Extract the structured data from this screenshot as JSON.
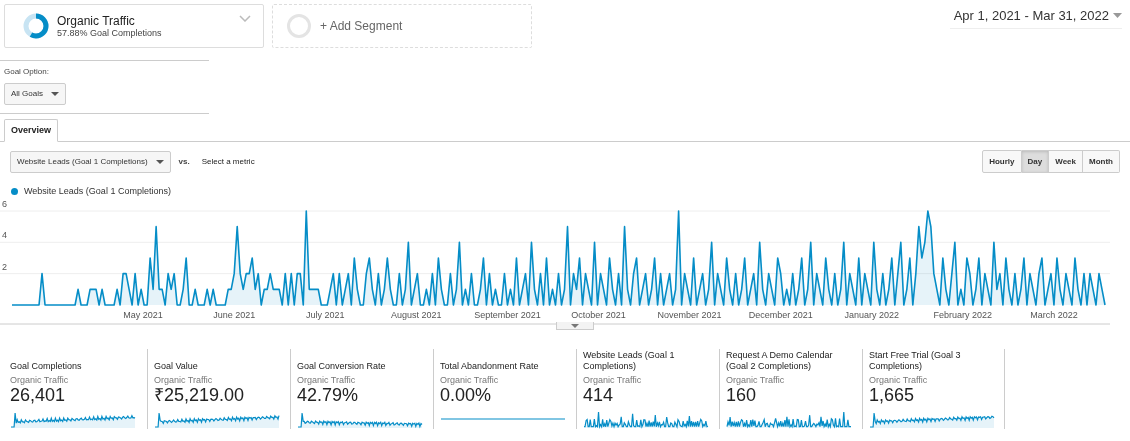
{
  "segments": [
    {
      "kind": "active",
      "name": "Organic Traffic",
      "subtitle": "57.88% Goal Completions"
    },
    {
      "kind": "add",
      "name": "+ Add Segment"
    }
  ],
  "date_range": "Apr 1, 2021 - Mar 31, 2022",
  "goal_option": {
    "label": "Goal Option:",
    "value": "All Goals"
  },
  "tabs": [
    {
      "label": "Overview",
      "selected": true
    }
  ],
  "metric_select": {
    "value": "Website Leads (Goal 1 Completions)",
    "vs": "vs.",
    "secondary": "Select a metric"
  },
  "granularity": [
    {
      "label": "Hourly",
      "selected": false
    },
    {
      "label": "Day",
      "selected": true
    },
    {
      "label": "Week",
      "selected": false
    },
    {
      "label": "Month",
      "selected": false
    }
  ],
  "chart": {
    "chart_data": {
      "type": "area",
      "series": [
        {
          "name": "Website Leads (Goal 1 Completions)",
          "color": "#058dc7",
          "values": [
            0,
            0,
            0,
            0,
            0,
            0,
            0,
            0,
            0,
            0,
            2,
            0,
            0,
            0,
            0,
            0,
            0,
            0,
            0,
            0,
            0,
            0,
            1,
            0,
            0,
            0,
            1,
            1,
            1,
            0,
            1,
            0,
            0,
            0,
            0,
            1,
            0,
            2,
            2,
            1,
            0,
            2,
            0,
            1,
            0,
            0,
            3,
            1,
            5,
            1,
            1,
            0,
            2,
            1,
            2,
            0,
            0,
            1,
            3,
            0,
            0,
            1,
            0,
            0,
            0,
            1,
            0,
            1,
            0,
            0,
            0,
            0,
            1,
            1,
            2,
            5,
            2,
            1,
            2,
            2,
            3,
            1,
            2,
            0,
            1,
            1,
            2,
            1,
            1,
            1,
            0,
            2,
            0,
            2,
            0,
            2,
            2,
            0,
            6,
            1,
            1,
            1,
            1,
            0,
            0,
            0,
            1,
            2,
            0,
            2,
            0,
            1,
            2,
            0,
            3,
            1,
            0,
            0,
            2,
            3,
            1,
            0,
            2,
            0,
            1,
            3,
            1,
            0,
            0,
            2,
            0,
            1,
            4,
            0,
            1,
            2,
            0,
            0,
            1,
            0,
            2,
            0,
            3,
            1,
            0,
            0,
            2,
            0,
            1,
            4,
            0,
            1,
            0,
            2,
            0,
            0,
            1,
            3,
            0,
            2,
            0,
            1,
            0,
            0,
            2,
            0,
            1,
            0,
            3,
            0,
            1,
            2,
            0,
            4,
            1,
            0,
            2,
            0,
            3,
            0,
            1,
            0,
            2,
            0,
            1,
            5,
            0,
            2,
            1,
            3,
            0,
            2,
            1,
            0,
            4,
            0,
            2,
            1,
            0,
            3,
            1,
            0,
            2,
            0,
            5,
            1,
            0,
            2,
            3,
            0,
            1,
            2,
            0,
            1,
            3,
            0,
            2,
            0,
            1,
            2,
            0,
            1,
            6,
            0,
            2,
            1,
            0,
            3,
            0,
            1,
            2,
            0,
            1,
            4,
            0,
            2,
            1,
            0,
            3,
            1,
            0,
            2,
            0,
            1,
            3,
            0,
            1,
            2,
            0,
            4,
            1,
            0,
            2,
            1,
            0,
            3,
            2,
            0,
            1,
            0,
            2,
            0,
            1,
            3,
            0,
            1,
            4,
            0,
            2,
            1,
            0,
            3,
            1,
            0,
            2,
            0,
            1,
            4,
            0,
            2,
            1,
            0,
            3,
            0,
            2,
            1,
            0,
            4,
            1,
            0,
            2,
            0,
            1,
            3,
            0,
            2,
            4,
            0,
            1,
            3,
            0,
            2,
            5,
            3,
            4,
            6,
            5,
            2,
            1,
            0,
            3,
            1,
            0,
            2,
            4,
            0,
            1,
            0,
            3,
            2,
            0,
            1,
            3,
            0,
            2,
            1,
            0,
            4,
            1,
            2,
            0,
            3,
            1,
            0,
            2,
            0,
            1,
            3,
            0,
            2,
            1,
            0,
            2,
            3,
            0,
            1,
            2,
            0,
            3,
            1,
            0,
            2,
            1,
            0,
            3,
            1,
            0,
            2,
            0,
            2,
            1,
            0,
            2,
            1,
            0
          ]
        }
      ],
      "ylim": [
        0,
        6
      ],
      "yticks": [
        2,
        4,
        6
      ],
      "grid": true
    },
    "axis_labels": [
      "May 2021",
      "June 2021",
      "July 2021",
      "August 2021",
      "September 2021",
      "October 2021",
      "November 2021",
      "December 2021",
      "January 2022",
      "February 2022",
      "March 2022"
    ]
  },
  "scorecards": [
    {
      "title": "Goal Completions",
      "segment": "Organic Traffic",
      "value": "26,401",
      "kind": "wave"
    },
    {
      "title": "Goal Value",
      "segment": "Organic Traffic",
      "value": "₹25,219.00",
      "kind": "wave"
    },
    {
      "title": "Goal Conversion Rate",
      "segment": "Organic Traffic",
      "value": "42.79%",
      "kind": "wave"
    },
    {
      "title": "Total Abandonment Rate",
      "segment": "Organic Traffic",
      "value": "0.00%",
      "kind": "flat"
    },
    {
      "title": "Website Leads (Goal 1 Completions)",
      "segment": "Organic Traffic",
      "value": "414",
      "kind": "spiky"
    },
    {
      "title": "Request A Demo Calendar (Goal 2 Completions)",
      "segment": "Organic Traffic",
      "value": "160",
      "kind": "spiky"
    },
    {
      "title": "Start Free Trial (Goal 3 Completions)",
      "segment": "Organic Traffic",
      "value": "1,665",
      "kind": "wave"
    }
  ]
}
